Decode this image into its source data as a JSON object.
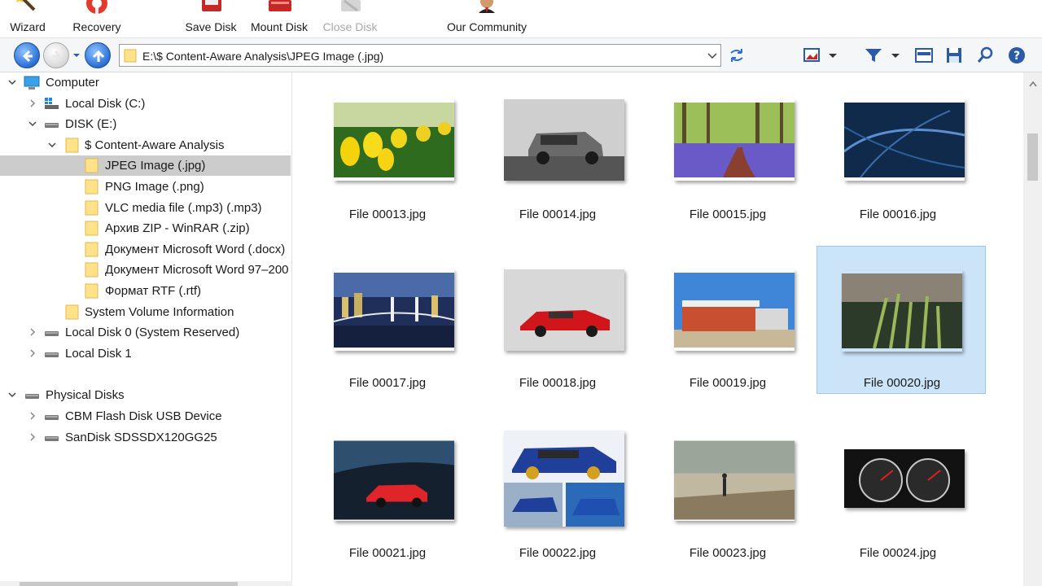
{
  "toolbar": {
    "wizard": "Wizard",
    "recovery": "Recovery",
    "save_disk": "Save Disk",
    "mount_disk": "Mount Disk",
    "close_disk": "Close Disk",
    "our_community": "Our Community"
  },
  "address": {
    "path": "E:\\$ Content-Aware Analysis\\JPEG Image (.jpg)"
  },
  "tree": {
    "computer": "Computer",
    "local_c": "Local Disk (C:)",
    "disk_e": "DISK (E:)",
    "content_aware": "$ Content-Aware Analysis",
    "jpeg": "JPEG Image (.jpg)",
    "png": "PNG Image (.png)",
    "vlc": "VLC media file (.mp3) (.mp3)",
    "zip": "Архив ZIP - WinRAR (.zip)",
    "docx": "Документ Microsoft Word (.docx)",
    "doc97": "Документ Microsoft Word 97–200",
    "rtf": "Формат RTF (.rtf)",
    "svi": "System Volume Information",
    "local0": "Local Disk 0 (System Reserved)",
    "local1": "Local Disk 1",
    "physical": "Physical Disks",
    "cbm": "CBM Flash Disk USB Device",
    "sandisk": "SanDisk SDSSDX120GG25"
  },
  "files": [
    {
      "name": "File 00013.jpg",
      "theme": "tulips"
    },
    {
      "name": "File 00014.jpg",
      "theme": "gray-suv"
    },
    {
      "name": "File 00015.jpg",
      "theme": "bluebell-forest"
    },
    {
      "name": "File 00016.jpg",
      "theme": "blue-abstract"
    },
    {
      "name": "File 00017.jpg",
      "theme": "city-bridge-night"
    },
    {
      "name": "File 00018.jpg",
      "theme": "red-sports-car"
    },
    {
      "name": "File 00019.jpg",
      "theme": "gas-station"
    },
    {
      "name": "File 00020.jpg",
      "theme": "grass-closeup",
      "selected": true
    },
    {
      "name": "File 00021.jpg",
      "theme": "red-car-night"
    },
    {
      "name": "File 00022.jpg",
      "theme": "blue-rally-cars"
    },
    {
      "name": "File 00023.jpg",
      "theme": "person-on-road"
    },
    {
      "name": "File 00024.jpg",
      "theme": "dashboard-gauges"
    }
  ],
  "colors": {
    "selection_tree": "#cccccc",
    "selection_content": "#cce4f7",
    "accent": "#2a6fd6"
  }
}
